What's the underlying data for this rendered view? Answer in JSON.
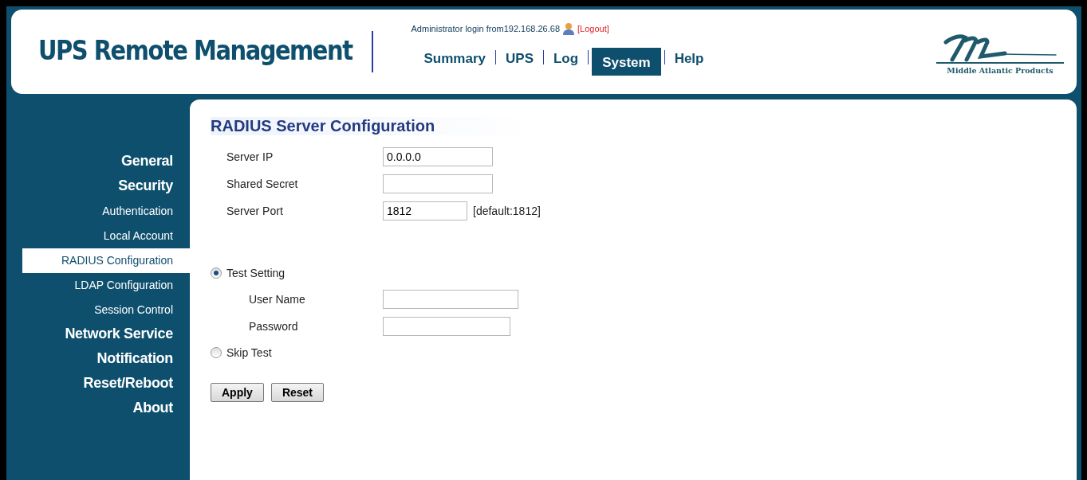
{
  "header": {
    "title": "UPS Remote Management",
    "login_text": "Administrator login from192.168.26.68",
    "logout": "[Logout]",
    "logo_text": "Middle Atlantic Products"
  },
  "nav": [
    {
      "label": "Summary",
      "selected": false
    },
    {
      "label": "UPS",
      "selected": false
    },
    {
      "label": "Log",
      "selected": false
    },
    {
      "label": "System",
      "selected": true
    },
    {
      "label": "Help",
      "selected": false
    }
  ],
  "sidebar": {
    "items": [
      {
        "label": "General",
        "kind": "section",
        "selected": false
      },
      {
        "label": "Security",
        "kind": "section",
        "selected": false
      },
      {
        "label": "Authentication",
        "kind": "sub",
        "selected": false
      },
      {
        "label": "Local Account",
        "kind": "sub",
        "selected": false
      },
      {
        "label": "RADIUS Configuration",
        "kind": "sub",
        "selected": true
      },
      {
        "label": "LDAP Configuration",
        "kind": "sub",
        "selected": false
      },
      {
        "label": "Session Control",
        "kind": "sub",
        "selected": false
      },
      {
        "label": "Network Service",
        "kind": "section",
        "selected": false
      },
      {
        "label": "Notification",
        "kind": "section",
        "selected": false
      },
      {
        "label": "Reset/Reboot",
        "kind": "section",
        "selected": false
      },
      {
        "label": "About",
        "kind": "section",
        "selected": false
      }
    ]
  },
  "form": {
    "title": "RADIUS Server Configuration",
    "fields": [
      {
        "label": "Server IP",
        "value": "0.0.0.0"
      },
      {
        "label": "Shared Secret"
      },
      {
        "label": "Server Port",
        "value": "1812",
        "hint": "[default:1812]"
      }
    ],
    "test_options": [
      {
        "label": "Test Setting",
        "selected": true,
        "fields": [
          {
            "label": "User Name"
          },
          {
            "label": "Password"
          }
        ]
      },
      {
        "label": "Skip Test",
        "selected": false
      }
    ],
    "buttons": [
      "Apply",
      "Reset"
    ]
  }
}
